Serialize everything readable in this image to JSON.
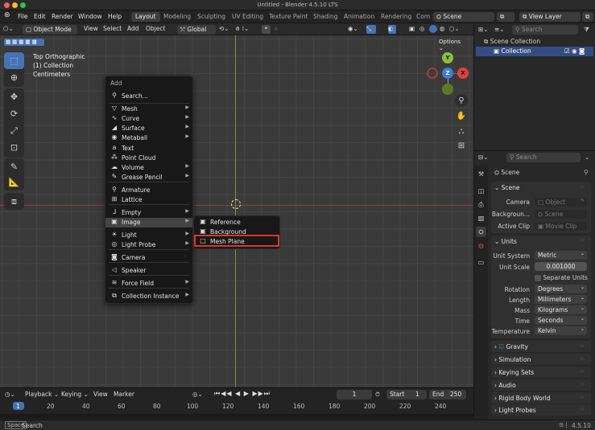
{
  "window": {
    "title": "Untitled - Blender 4.5.10 LTS"
  },
  "topbar": {
    "menus": [
      "File",
      "Edit",
      "Render",
      "Window",
      "Help"
    ],
    "workspaces": [
      "Layout",
      "Modeling",
      "Sculpting",
      "UV Editing",
      "Texture Paint",
      "Shading",
      "Animation",
      "Rendering",
      "Com"
    ],
    "scene": "Scene",
    "view_layer": "View Layer"
  },
  "viewport_header": {
    "mode": "Object Mode",
    "menus": [
      "View",
      "Select",
      "Add",
      "Object"
    ],
    "transform": "Global",
    "options": "Options",
    "search_placeholder": "Search"
  },
  "viewport": {
    "info": [
      "Top Orthographic",
      "(1) Collection",
      "Centimeters"
    ],
    "navigator": {
      "y": "Y",
      "z": "Z",
      "x": "X"
    }
  },
  "add_menu": {
    "title": "Add",
    "search": "Search...",
    "items": [
      {
        "label": "Mesh",
        "icon": "▽",
        "sub": true
      },
      {
        "label": "Curve",
        "icon": "∿",
        "sub": true
      },
      {
        "label": "Surface",
        "icon": "◢",
        "sub": true
      },
      {
        "label": "Metaball",
        "icon": "◉",
        "sub": true
      },
      {
        "label": "Text",
        "icon": "a",
        "sub": false
      },
      {
        "label": "Point Cloud",
        "icon": "⁂",
        "sub": false
      },
      {
        "label": "Volume",
        "icon": "☁",
        "sub": true
      },
      {
        "label": "Grease Pencil",
        "icon": "✎",
        "sub": true
      },
      {
        "label": "Armature",
        "icon": "⚲",
        "sub": false
      },
      {
        "label": "Lattice",
        "icon": "⊞",
        "sub": false
      },
      {
        "label": "Empty",
        "icon": "⅃",
        "sub": true
      },
      {
        "label": "Image",
        "icon": "▣",
        "sub": true
      },
      {
        "label": "Light",
        "icon": "☀",
        "sub": true
      },
      {
        "label": "Light Probe",
        "icon": "◎",
        "sub": true
      },
      {
        "label": "Camera",
        "icon": "◙",
        "sub": false
      },
      {
        "label": "Speaker",
        "icon": "◁",
        "sub": false
      },
      {
        "label": "Force Field",
        "icon": "≋",
        "sub": true
      },
      {
        "label": "Collection Instance",
        "icon": "⧉",
        "sub": true
      }
    ]
  },
  "image_submenu": {
    "items": [
      "Reference",
      "Background",
      "Mesh Plane"
    ]
  },
  "timeline": {
    "menus": [
      "Playback",
      "Keying",
      "View",
      "Marker"
    ],
    "current_frame": "1",
    "start_label": "Start",
    "start": "1",
    "end_label": "End",
    "end": "250",
    "frames": [
      "1",
      "20",
      "40",
      "60",
      "80",
      "100",
      "120",
      "140",
      "160",
      "180",
      "200",
      "220",
      "240"
    ]
  },
  "status": {
    "left": "Search",
    "version": "4.5.10"
  },
  "outliner": {
    "search_placeholder": "Search",
    "root": "Scene Collection",
    "collection": "Collection"
  },
  "properties": {
    "search_placeholder": "Search",
    "context": "Scene",
    "scene_panel": {
      "title": "Scene",
      "camera_label": "Camera",
      "camera_value": "Object",
      "background_label": "Backgroun...",
      "background_value": "Scene",
      "clip_label": "Active Clip",
      "clip_value": "Movie Clip"
    },
    "units_panel": {
      "title": "Units",
      "unit_system_label": "Unit System",
      "unit_system": "Metric",
      "unit_scale_label": "Unit Scale",
      "unit_scale": "0.001000",
      "separate_units": "Separate Units",
      "rotation_label": "Rotation",
      "rotation": "Degrees",
      "length_label": "Length",
      "length": "Millimeters",
      "mass_label": "Mass",
      "mass": "Kilograms",
      "time_label": "Time",
      "time": "Seconds",
      "temp_label": "Temperature",
      "temp": "Kelvin"
    },
    "collapsed": [
      "Gravity",
      "Simulation",
      "Keying Sets",
      "Audio",
      "Rigid Body World",
      "Light Probes"
    ]
  },
  "colors": {
    "accent": "#4772b3",
    "highlight_box": "#e0352c",
    "x_axis": "#e0413f",
    "y_axis": "#8bbf3a",
    "z_axis": "#3c7ddc"
  }
}
